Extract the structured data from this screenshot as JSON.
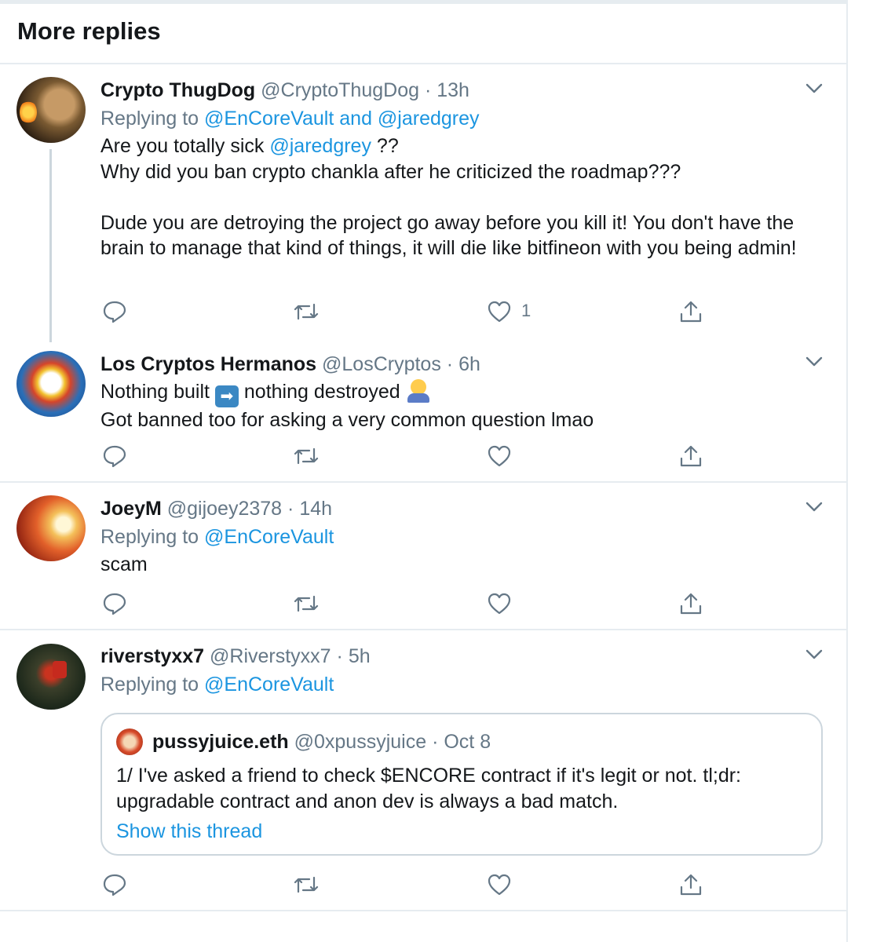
{
  "section_title": "More replies",
  "actions_icons": [
    "reply-icon",
    "retweet-icon",
    "like-icon",
    "share-icon"
  ],
  "tweets": [
    {
      "name": "Crypto ThugDog",
      "handle": "@CryptoThugDog",
      "sep": " · ",
      "time": "13h",
      "replying_prefix": "Replying to ",
      "replying_to_1": "@EnCoreVault",
      "replying_and": " and ",
      "replying_to_2": "@jaredgrey",
      "line1_a": "Are you totally sick ",
      "line1_mention": "@jaredgrey",
      "line1_b": " ??",
      "line2": "Why did you ban crypto chankla after he criticized the roadmap???",
      "line3": "Dude you are detroying the project go away before you kill it! You don't have the brain to manage that kind of things, it will die like bitfineon with you being admin!",
      "like_count": "1"
    },
    {
      "name": "Los Cryptos Hermanos",
      "handle": "@LosCryptos",
      "sep": " · ",
      "time": "6h",
      "line1_a": "Nothing built ",
      "line1_arrow": "➡",
      "line1_b": " nothing destroyed ",
      "line2": "Got banned too for asking a very common question lmao"
    },
    {
      "name": "JoeyM",
      "handle": "@gijoey2378",
      "sep": " · ",
      "time": "14h",
      "replying_prefix": "Replying to ",
      "replying_to_1": "@EnCoreVault",
      "line1": "scam"
    },
    {
      "name": "riverstyxx7",
      "handle": "@Riverstyxx7",
      "sep": " · ",
      "time": "5h",
      "replying_prefix": "Replying to ",
      "replying_to_1": "@EnCoreVault",
      "quote": {
        "name": "pussyjuice.eth",
        "handle": "@0xpussyjuice",
        "sep": " · ",
        "date": "Oct 8",
        "text": "1/ I've asked a friend to check $ENCORE contract if it's legit or not. tl;dr: upgradable contract and anon dev is always a bad match.",
        "show_thread": "Show this thread"
      }
    }
  ]
}
